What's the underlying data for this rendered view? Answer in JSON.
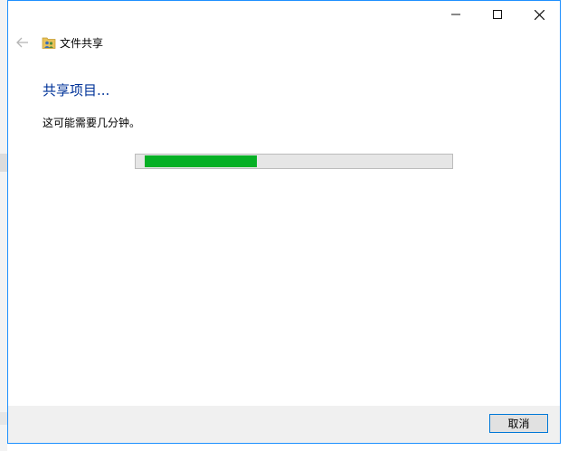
{
  "window": {
    "title": "文件共享",
    "controls": {
      "minimize_icon": "minimize-icon",
      "maximize_icon": "maximize-icon",
      "close_icon": "close-icon"
    }
  },
  "nav": {
    "back_icon": "back-arrow-icon",
    "app_icon": "file-sharing-icon"
  },
  "main": {
    "heading": "共享项目...",
    "message": "这可能需要几分钟。",
    "progress_fraction": 0.375
  },
  "footer": {
    "cancel_label": "取消"
  },
  "colors": {
    "accent": "#0078d7",
    "heading": "#003399",
    "progress_fill": "#06b025",
    "progress_track": "#e6e6e6",
    "footer_bg": "#f0f0f0"
  }
}
